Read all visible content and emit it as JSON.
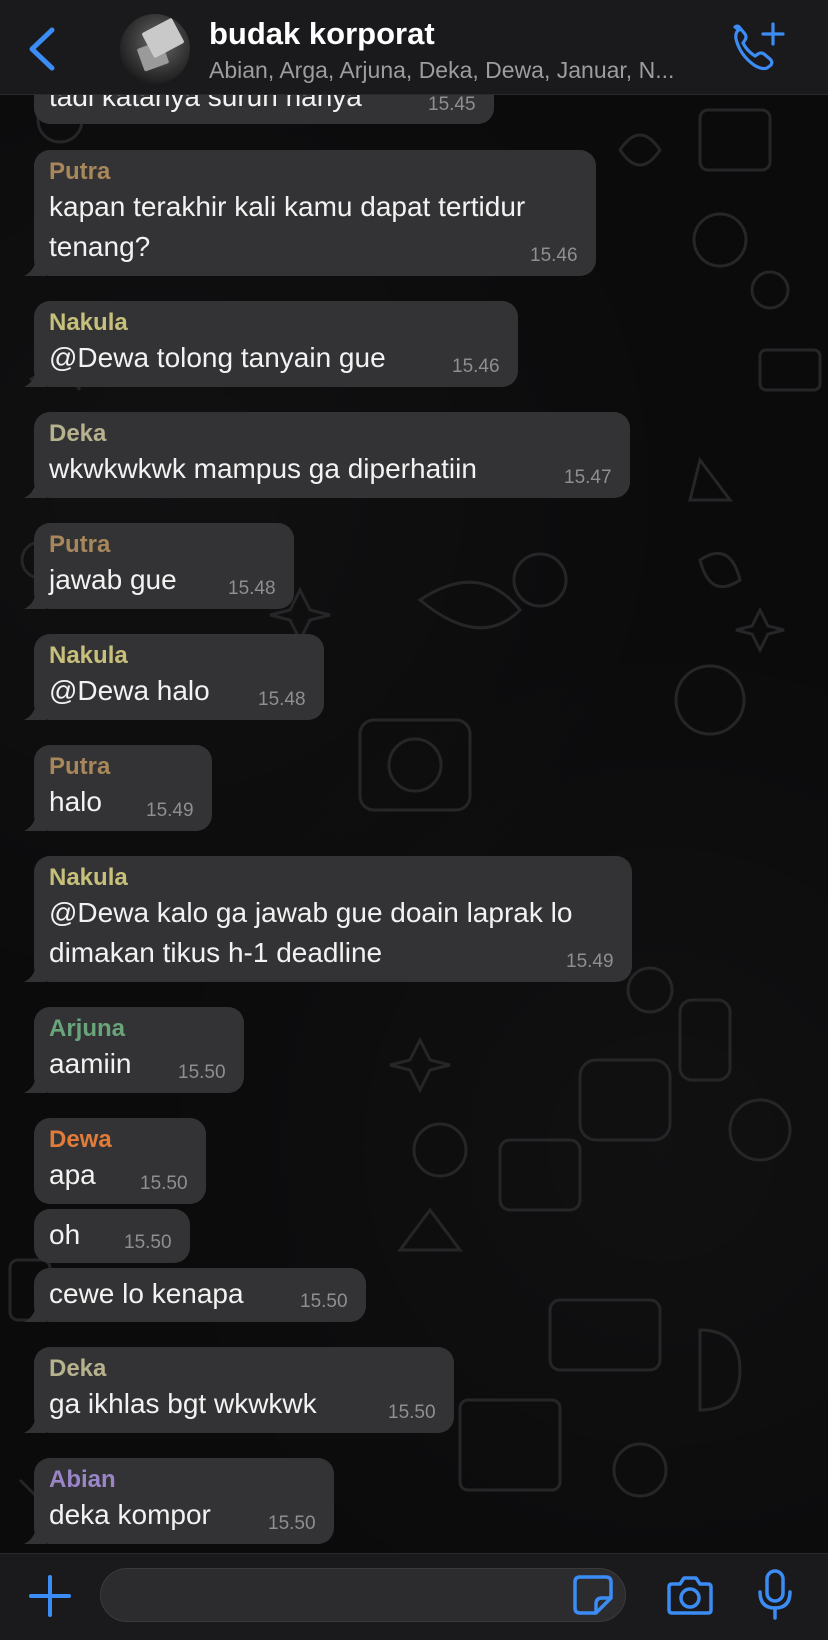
{
  "header": {
    "title": "budak korporat",
    "subtitle": "Abian, Arga, Arjuna, Deka, Dewa, Januar, N..."
  },
  "colors": {
    "accent": "#3b8df5",
    "bubble": "#333335",
    "Putra": "#a8885a",
    "Nakula": "#c7c07a",
    "Deka": "#b7b28e",
    "Arjuna": "#69a57a",
    "Dewa": "#e07b3a",
    "Abian": "#9b85c9"
  },
  "messages": [
    {
      "sender": "",
      "text": "tadi katanya suruh nanya",
      "time": "15.45"
    },
    {
      "sender": "Putra",
      "text": "kapan terakhir kali kamu dapat tertidur",
      "text2": "tenang?",
      "time": "15.46"
    },
    {
      "sender": "Nakula",
      "text": "@Dewa tolong tanyain gue",
      "time": "15.46"
    },
    {
      "sender": "Deka",
      "text": "wkwkwkwk mampus ga diperhatiin",
      "time": "15.47"
    },
    {
      "sender": "Putra",
      "text": "jawab gue",
      "time": "15.48"
    },
    {
      "sender": "Nakula",
      "text": "@Dewa halo",
      "time": "15.48"
    },
    {
      "sender": "Putra",
      "text": "halo",
      "time": "15.49"
    },
    {
      "sender": "Nakula",
      "text": "@Dewa kalo ga jawab gue doain laprak lo",
      "text2": "dimakan tikus h-1 deadline",
      "time": "15.49"
    },
    {
      "sender": "Arjuna",
      "text": "aamiin",
      "time": "15.50"
    },
    {
      "sender": "Dewa",
      "text": "apa",
      "time": "15.50"
    },
    {
      "sender": "",
      "text": "oh",
      "time": "15.50"
    },
    {
      "sender": "",
      "text": "cewe lo kenapa",
      "time": "15.50"
    },
    {
      "sender": "Deka",
      "text": "ga ikhlas bgt wkwkwk",
      "time": "15.50"
    },
    {
      "sender": "Abian",
      "text": "deka kompor",
      "time": "15.50"
    }
  ],
  "input": {
    "value": "",
    "placeholder": ""
  },
  "icons": {
    "back": "chevron-left-icon",
    "call": "add-call-icon",
    "plus": "plus-icon",
    "sticker": "sticker-icon",
    "camera": "camera-icon",
    "mic": "microphone-icon"
  }
}
